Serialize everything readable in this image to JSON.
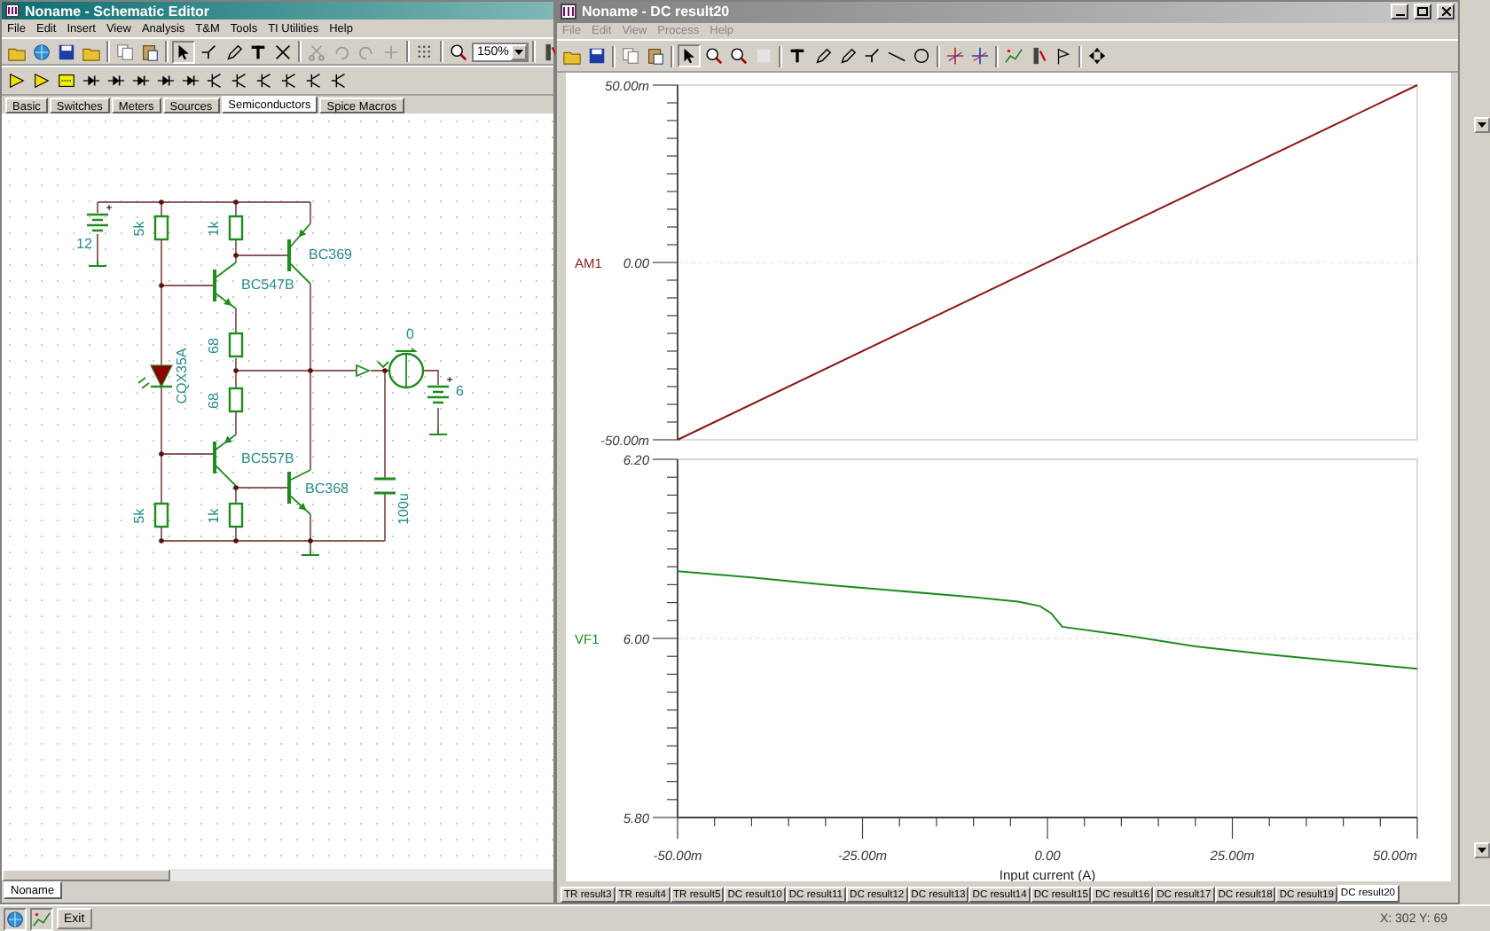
{
  "left_window": {
    "title": "Noname - Schematic Editor",
    "active": true,
    "menu": [
      "File",
      "Edit",
      "Insert",
      "View",
      "Analysis",
      "T&M",
      "Tools",
      "TI Utilities",
      "Help"
    ],
    "zoom": "150%",
    "component_tabs": [
      {
        "label": "Basic",
        "selected": false
      },
      {
        "label": "Switches",
        "selected": false
      },
      {
        "label": "Meters",
        "selected": false
      },
      {
        "label": "Sources",
        "selected": false
      },
      {
        "label": "Semiconductors",
        "selected": true
      },
      {
        "label": "Spice Macros",
        "selected": false
      }
    ],
    "schematic_labels": [
      "12",
      "5k",
      "1k",
      "BC369",
      "BC547B",
      "68",
      "68",
      "CQX35A",
      "BC557B",
      "BC368",
      "5k",
      "1k",
      "100u",
      "0",
      "6"
    ],
    "document_tabs": [
      {
        "label": "Noname",
        "selected": true
      }
    ]
  },
  "right_window": {
    "title": "Noname - DC result20",
    "active": false,
    "menu": [
      "File",
      "Edit",
      "View",
      "Process",
      "Help"
    ],
    "charts": [
      {
        "chart_data": {
          "type": "line",
          "x": [
            -50,
            50
          ],
          "xlim": [
            -50,
            50
          ],
          "ylim": [
            -50,
            50
          ],
          "yticks": [
            {
              "value": -50,
              "label": "-50.00m"
            },
            {
              "value": 0,
              "label": "0.00"
            },
            {
              "value": 50,
              "label": "50.00m"
            }
          ],
          "series": [
            {
              "name": "AM1",
              "color": "#8b1a1a",
              "values": [
                -50,
                50
              ]
            }
          ]
        }
      },
      {
        "chart_data": {
          "type": "line",
          "x": [
            -50,
            -40,
            -30,
            -20,
            -10,
            -4,
            -1,
            0.5,
            2,
            10,
            20,
            30,
            40,
            50
          ],
          "xlim": [
            -50,
            50
          ],
          "ylim": [
            5.8,
            6.2
          ],
          "xlabel": "Input current (A)",
          "xticks": [
            {
              "value": -50,
              "label": "-50.00m"
            },
            {
              "value": -25,
              "label": "-25.00m"
            },
            {
              "value": 0,
              "label": "0.00"
            },
            {
              "value": 25,
              "label": "25.00m"
            },
            {
              "value": 50,
              "label": "50.00m"
            }
          ],
          "yticks": [
            {
              "value": 5.8,
              "label": "5.80"
            },
            {
              "value": 6.0,
              "label": "6.00"
            },
            {
              "value": 6.2,
              "label": "6.20"
            }
          ],
          "series": [
            {
              "name": "VF1",
              "color": "#1e8c1e",
              "values": [
                6.075,
                6.068,
                6.06,
                6.053,
                6.046,
                6.041,
                6.036,
                6.028,
                6.013,
                6.004,
                5.991,
                5.982,
                5.974,
                5.966
              ]
            }
          ]
        }
      }
    ],
    "result_tabs": [
      {
        "label": "TR result3",
        "selected": false
      },
      {
        "label": "TR result4",
        "selected": false
      },
      {
        "label": "TR result5",
        "selected": false
      },
      {
        "label": "DC result10",
        "selected": false
      },
      {
        "label": "DC result11",
        "selected": false
      },
      {
        "label": "DC result12",
        "selected": false
      },
      {
        "label": "DC result13",
        "selected": false
      },
      {
        "label": "DC result14",
        "selected": false
      },
      {
        "label": "DC result15",
        "selected": false
      },
      {
        "label": "DC result16",
        "selected": false
      },
      {
        "label": "DC result17",
        "selected": false
      },
      {
        "label": "DC result18",
        "selected": false
      },
      {
        "label": "DC result19",
        "selected": false
      },
      {
        "label": "DC result20",
        "selected": true
      }
    ]
  },
  "status_bar": {
    "exit_button": "Exit",
    "coordinates": "X: 302 Y: 69"
  }
}
